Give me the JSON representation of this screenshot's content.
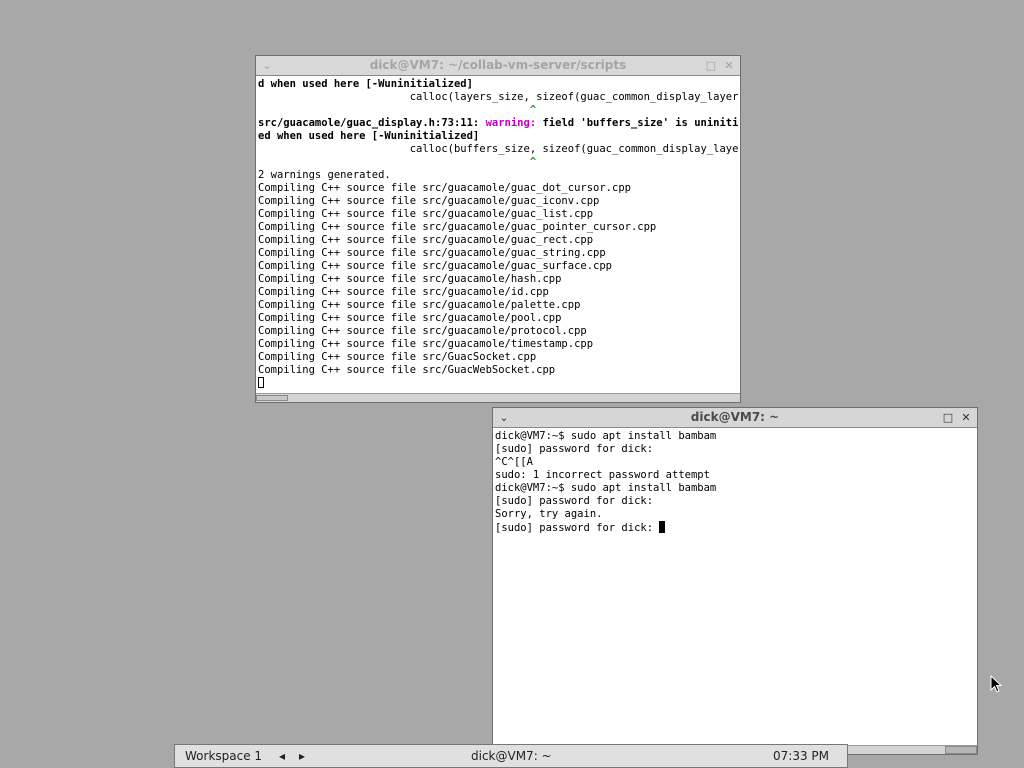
{
  "window1": {
    "title": "dick@VM7: ~/collab-vm-server/scripts",
    "lines": [
      {
        "t": "bold",
        "text": "d when used here [-Wuninitialized]"
      },
      {
        "t": "plain",
        "text": "                        calloc(layers_size, sizeof(guac_common_display_layer)),"
      },
      {
        "t": "caret",
        "text": "                                           ^"
      },
      {
        "t": "warnline",
        "a": "src/guacamole/guac_display.h:73:11: ",
        "b": "warning:",
        "c": " field 'buffers_size' is uninitializ"
      },
      {
        "t": "bold",
        "text": "ed when used here [-Wuninitialized]"
      },
      {
        "t": "plain",
        "text": "                        calloc(buffers_size, sizeof(guac_common_display_layer)))"
      },
      {
        "t": "caret",
        "text": "                                           ^"
      },
      {
        "t": "plain",
        "text": "2 warnings generated."
      },
      {
        "t": "plain",
        "text": "Compiling C++ source file src/guacamole/guac_dot_cursor.cpp"
      },
      {
        "t": "plain",
        "text": "Compiling C++ source file src/guacamole/guac_iconv.cpp"
      },
      {
        "t": "plain",
        "text": "Compiling C++ source file src/guacamole/guac_list.cpp"
      },
      {
        "t": "plain",
        "text": "Compiling C++ source file src/guacamole/guac_pointer_cursor.cpp"
      },
      {
        "t": "plain",
        "text": "Compiling C++ source file src/guacamole/guac_rect.cpp"
      },
      {
        "t": "plain",
        "text": "Compiling C++ source file src/guacamole/guac_string.cpp"
      },
      {
        "t": "plain",
        "text": "Compiling C++ source file src/guacamole/guac_surface.cpp"
      },
      {
        "t": "plain",
        "text": "Compiling C++ source file src/guacamole/hash.cpp"
      },
      {
        "t": "plain",
        "text": "Compiling C++ source file src/guacamole/id.cpp"
      },
      {
        "t": "plain",
        "text": "Compiling C++ source file src/guacamole/palette.cpp"
      },
      {
        "t": "plain",
        "text": "Compiling C++ source file src/guacamole/pool.cpp"
      },
      {
        "t": "plain",
        "text": "Compiling C++ source file src/guacamole/protocol.cpp"
      },
      {
        "t": "plain",
        "text": "Compiling C++ source file src/guacamole/timestamp.cpp"
      },
      {
        "t": "plain",
        "text": "Compiling C++ source file src/GuacSocket.cpp"
      },
      {
        "t": "plain",
        "text": "Compiling C++ source file src/GuacWebSocket.cpp"
      },
      {
        "t": "cursorbox",
        "text": ""
      }
    ]
  },
  "window2": {
    "title": "dick@VM7: ~",
    "lines": [
      {
        "t": "plain",
        "text": "dick@VM7:~$ sudo apt install bambam"
      },
      {
        "t": "plain",
        "text": "[sudo] password for dick:"
      },
      {
        "t": "plain",
        "text": "^C^[[A"
      },
      {
        "t": "plain",
        "text": "sudo: 1 incorrect password attempt"
      },
      {
        "t": "plain",
        "text": "dick@VM7:~$ sudo apt install bambam"
      },
      {
        "t": "plain",
        "text": "[sudo] password for dick:"
      },
      {
        "t": "plain",
        "text": "Sorry, try again."
      },
      {
        "t": "cursorblock",
        "text": "[sudo] password for dick: "
      }
    ]
  },
  "taskbar": {
    "workspace": "Workspace 1",
    "prev_arrow": "◂",
    "next_arrow": "▸",
    "task": "dick@VM7: ~",
    "clock": "07:33 PM"
  },
  "titlebar_icons": {
    "menu": "⌄",
    "maximize": "□",
    "close": "✕"
  }
}
